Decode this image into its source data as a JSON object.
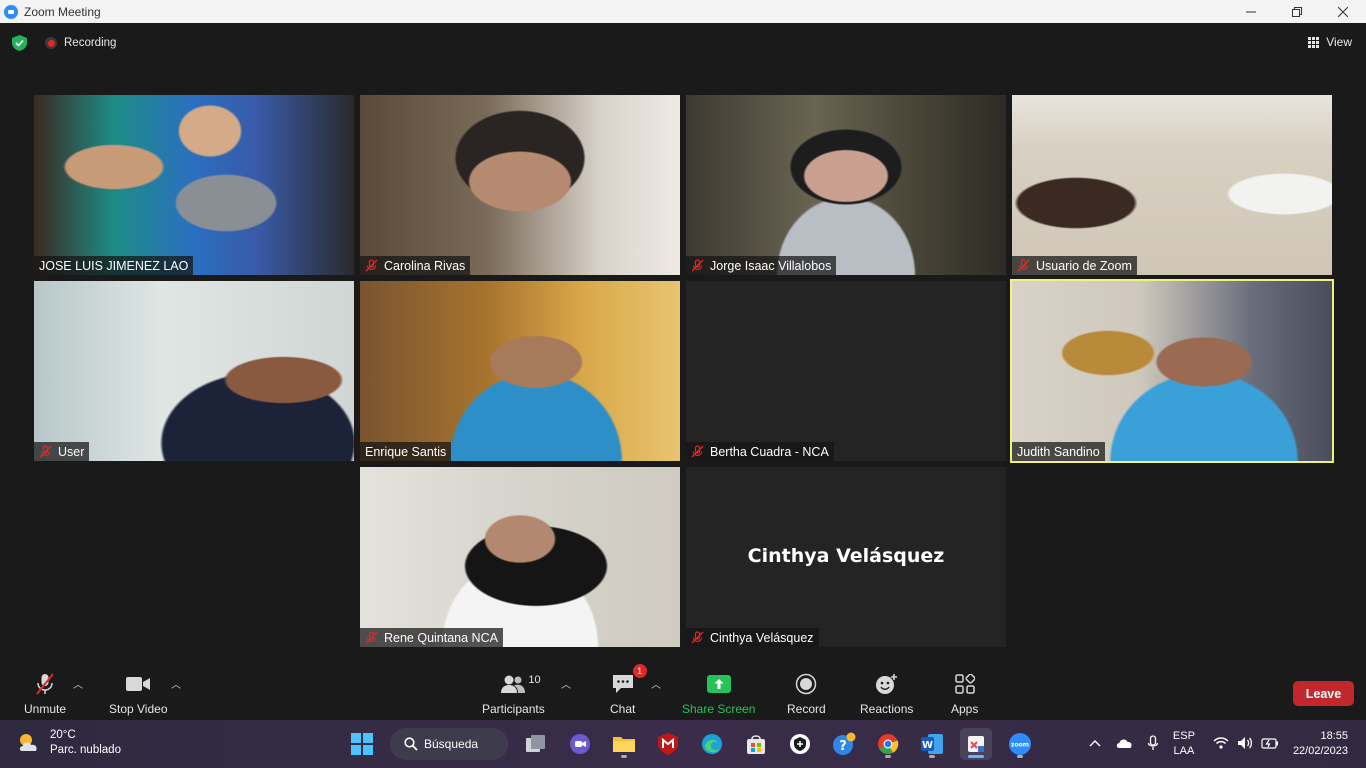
{
  "window": {
    "title": "Zoom Meeting"
  },
  "topbar": {
    "recording_label": "Recording",
    "view_label": "View"
  },
  "participants": [
    {
      "name": "JOSE LUIS JIMENEZ LAO",
      "muted": false
    },
    {
      "name": "Carolina Rivas",
      "muted": true
    },
    {
      "name": "Jorge Isaac Villalobos",
      "muted": true
    },
    {
      "name": "Usuario de Zoom",
      "muted": true
    },
    {
      "name": "User",
      "muted": true
    },
    {
      "name": "Enrique Santis",
      "muted": false
    },
    {
      "name": "Bertha Cuadra - NCA",
      "muted": true
    },
    {
      "name": "Judith Sandino",
      "muted": false,
      "active_speaker": true
    },
    {
      "name": "Rene Quintana NCA",
      "muted": true
    },
    {
      "name": "Cinthya Velásquez",
      "muted": true,
      "video_off": true
    }
  ],
  "controls": {
    "unmute_label": "Unmute",
    "stop_video_label": "Stop Video",
    "participants_label": "Participants",
    "participants_count": "10",
    "chat_label": "Chat",
    "chat_badge": "1",
    "share_label": "Share Screen",
    "record_label": "Record",
    "reactions_label": "Reactions",
    "apps_label": "Apps",
    "leave_label": "Leave"
  },
  "taskbar": {
    "weather_temp": "20°C",
    "weather_desc": "Parc. nublado",
    "search_label": "Búsqueda",
    "lang_top": "ESP",
    "lang_bottom": "LAA",
    "time": "18:55",
    "date": "22/02/2023"
  },
  "colors": {
    "active_speaker": "#f0f27a",
    "share": "#27c25a",
    "leave": "#c1272d",
    "muted_red": "#e02828"
  }
}
